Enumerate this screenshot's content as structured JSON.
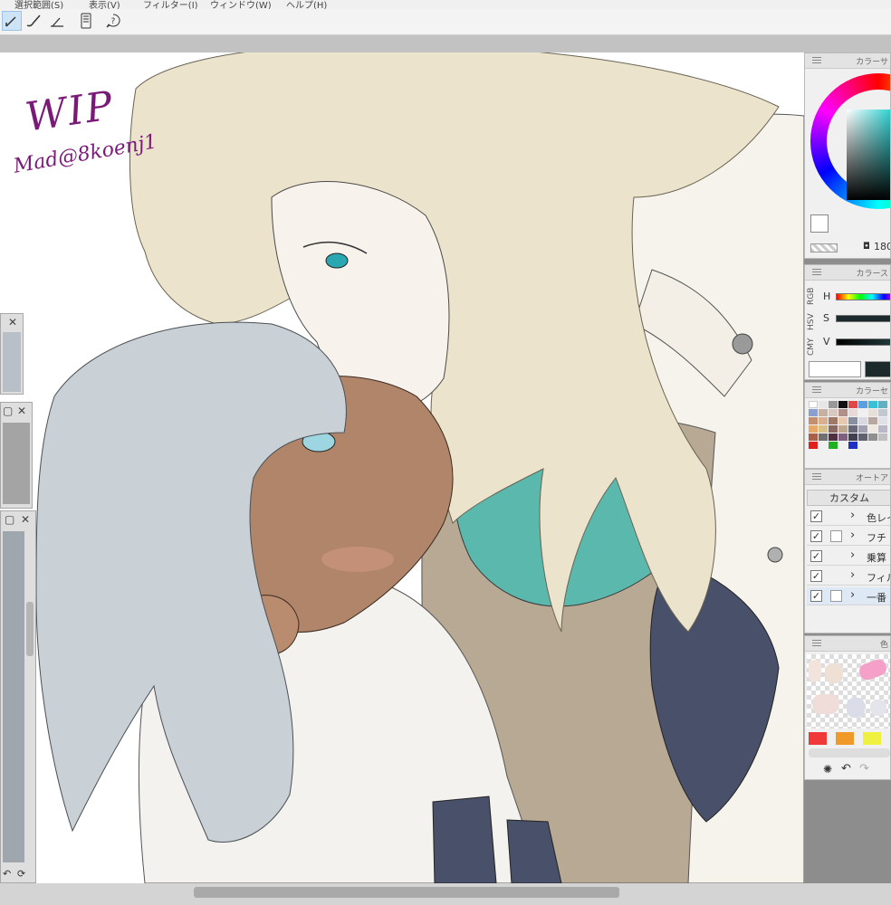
{
  "menu": {
    "items": [
      "選択範囲(S)",
      "表示(V)",
      "フィルター(I)",
      "ウィンドウ(W)",
      "ヘルプ(H)"
    ]
  },
  "canvas": {
    "watermark_title": "WIP",
    "watermark_signature": "Mad@8koenj1"
  },
  "color_wheel": {
    "title": "カラーサ",
    "readout": "180"
  },
  "color_slider": {
    "title": "カラース",
    "tabs": [
      "RGB",
      "HSV",
      "CMY"
    ],
    "labels": [
      "H",
      "S",
      "V"
    ]
  },
  "color_set": {
    "title": "カラーセ"
  },
  "auto_action": {
    "title": "オートア",
    "set_name": "カスタム",
    "items": [
      {
        "label": "色レイ",
        "checked": true
      },
      {
        "label": "フチ",
        "checked": true
      },
      {
        "label": "乗算",
        "checked": true
      },
      {
        "label": "フィル",
        "checked": true
      },
      {
        "label": "一番",
        "checked": true
      }
    ]
  },
  "color_history": {
    "title": "色"
  },
  "colors": {
    "accent_select": "#cde4f7",
    "watermark": "#7a1a78",
    "hair_blonde": "#ece3cc",
    "hair_silver": "#c9d1d6",
    "teal": "#5ab8ad",
    "navy": "#48506a"
  }
}
